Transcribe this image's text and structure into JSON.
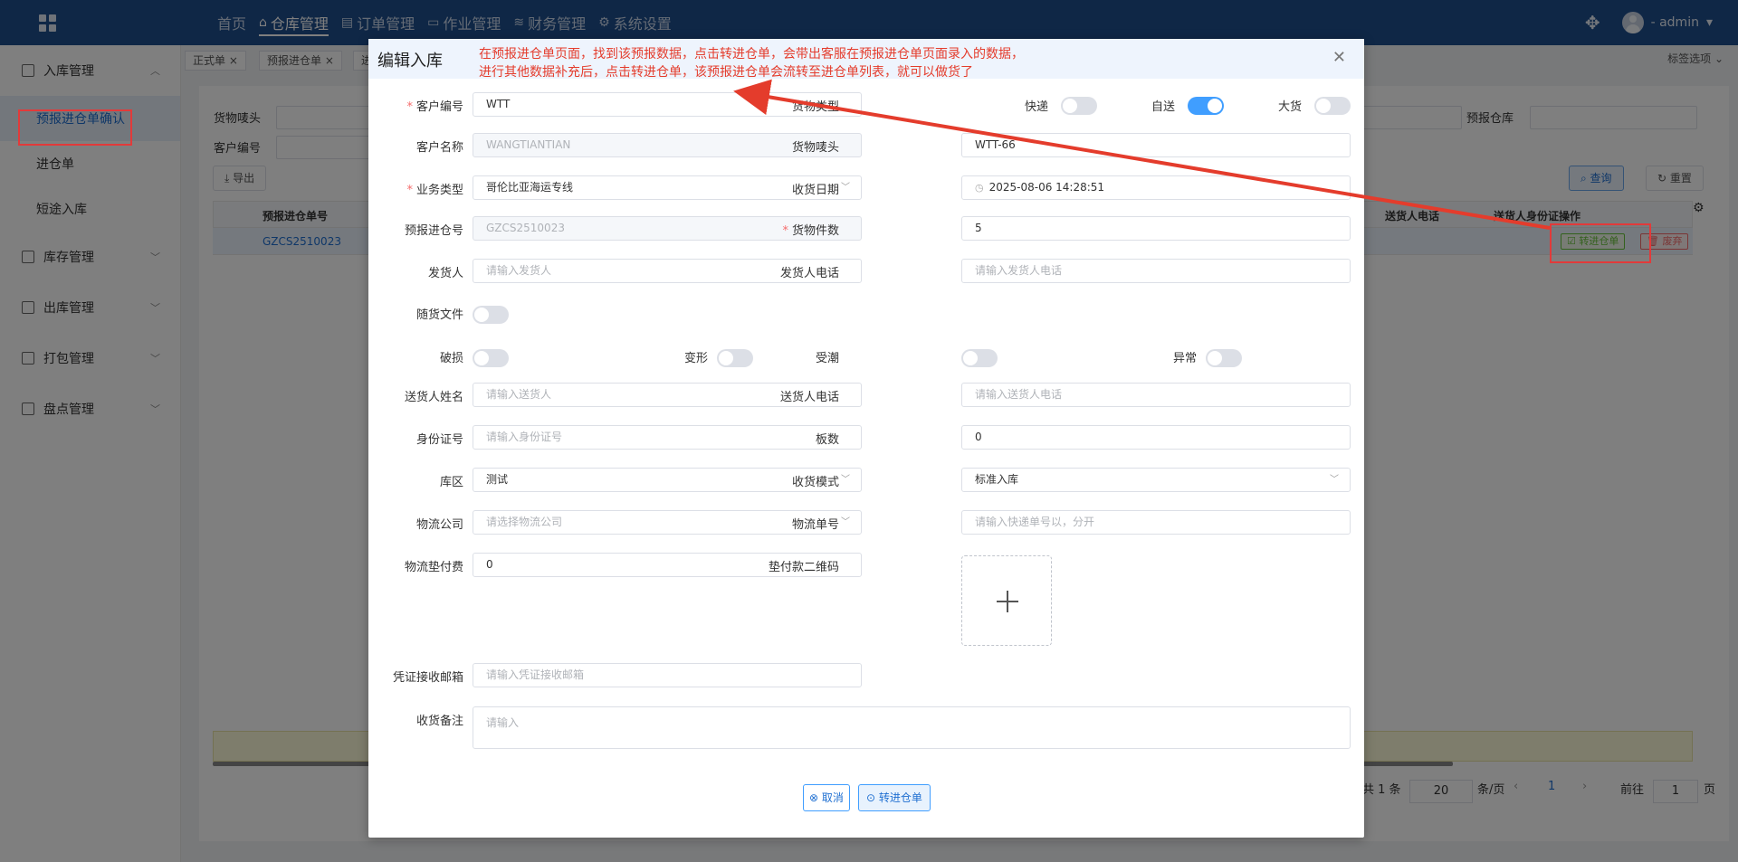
{
  "topnav": {
    "items": [
      {
        "icon": "",
        "label": "首页"
      },
      {
        "icon": "home-icon",
        "label": "仓库管理",
        "active": true
      },
      {
        "icon": "document-icon",
        "label": "订单管理"
      },
      {
        "icon": "folder-icon",
        "label": "作业管理"
      },
      {
        "icon": "database-icon",
        "label": "财务管理"
      },
      {
        "icon": "gear-icon",
        "label": "系统设置"
      }
    ],
    "user": "- admin"
  },
  "sidebar": {
    "groups": [
      {
        "label": "入库管理",
        "items": [
          "预报进仓单确认",
          "进仓单",
          "短途入库"
        ]
      },
      {
        "label": "库存管理"
      },
      {
        "label": "出库管理"
      },
      {
        "label": "打包管理"
      },
      {
        "label": "盘点管理"
      }
    ]
  },
  "tags": {
    "items": [
      "正式单",
      "预报进仓单",
      "进"
    ],
    "options": "标签选项"
  },
  "background": {
    "filters": {
      "cargo_mark": "货物唛头",
      "customer_code": "客户编号",
      "forecast_warehouse": "预报仓库"
    },
    "buttons": {
      "export": "导出",
      "query": "查询",
      "reset": "重置"
    },
    "table": {
      "headers": {
        "forecast_no": "预报进仓单号",
        "sender_phone": "送货人电话",
        "sender_id": "送货人身份证",
        "ops": "操作"
      },
      "row_no": "GZCS2510023",
      "op_convert": "转进仓单",
      "op_discard": "废弃"
    },
    "pager": {
      "total": "共 1 条",
      "page_size": "20",
      "per_page": "条/页",
      "current": "1",
      "goto": "前往",
      "goto_value": "1",
      "page_unit": "页"
    }
  },
  "dialog": {
    "title": "编辑入库",
    "annotation_line1": "在预报进仓单页面，找到该预报数据，点击转进仓单，会带出客服在预报进仓单页面录入的数据，",
    "annotation_line2": "进行其他数据补充后，点击转进仓单，该预报进仓单会流转至进仓单列表，就可以做货了",
    "fields": {
      "customer_code": {
        "label": "客户编号",
        "value": "WTT"
      },
      "cargo_type": {
        "label": "货物类型",
        "express": "快递",
        "self_delivery": "自送",
        "bulk": "大货"
      },
      "customer_name": {
        "label": "客户名称",
        "value": "WANGTIANTIAN"
      },
      "cargo_mark": {
        "label": "货物唛头",
        "value": "WTT-66"
      },
      "business_type": {
        "label": "业务类型",
        "value": "哥伦比亚海运专线"
      },
      "receive_date": {
        "label": "收货日期",
        "value": "2025-08-06 14:28:51"
      },
      "forecast_no": {
        "label": "预报进仓号",
        "value": "GZCS2510023"
      },
      "piece_count": {
        "label": "货物件数",
        "value": "5"
      },
      "shipper": {
        "label": "发货人",
        "placeholder": "请输入发货人"
      },
      "shipper_phone": {
        "label": "发货人电话",
        "placeholder": "请输入发货人电话"
      },
      "accompanying_docs": {
        "label": "随货文件"
      },
      "damaged": {
        "label": "破损"
      },
      "deformed": {
        "label": "变形"
      },
      "damp": {
        "label": "受潮"
      },
      "abnormal": {
        "label": "异常"
      },
      "deliverer_name": {
        "label": "送货人姓名",
        "placeholder": "请输入送货人"
      },
      "deliverer_phone": {
        "label": "送货人电话",
        "placeholder": "请输入送货人电话"
      },
      "id_number": {
        "label": "身份证号",
        "placeholder": "请输入身份证号"
      },
      "pallets": {
        "label": "板数",
        "value": "0"
      },
      "zone": {
        "label": "库区",
        "value": "测试"
      },
      "receive_mode": {
        "label": "收货模式",
        "value": "标准入库"
      },
      "logistics_company": {
        "label": "物流公司",
        "placeholder": "请选择物流公司"
      },
      "tracking_no": {
        "label": "物流单号",
        "placeholder": "请输入快递单号以，分开"
      },
      "logistics_fee": {
        "label": "物流垫付费",
        "value": "0"
      },
      "payment_qr": {
        "label": "垫付款二维码"
      },
      "voucher_email": {
        "label": "凭证接收邮箱",
        "placeholder": "请输入凭证接收邮箱"
      },
      "remarks": {
        "label": "收货备注",
        "placeholder": "请输入"
      }
    },
    "buttons": {
      "cancel": "取消",
      "convert": "转进仓单"
    }
  },
  "colors": {
    "header_bg": "#1f4e8c",
    "annotation": "#e43c2c",
    "primary": "#409eff"
  }
}
